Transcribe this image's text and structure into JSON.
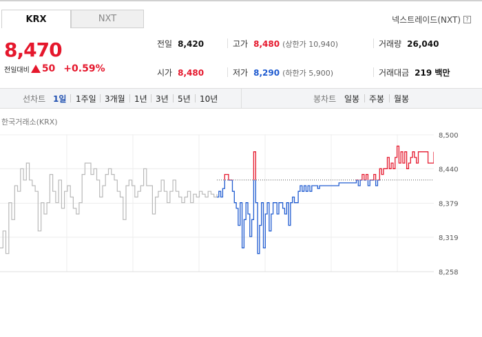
{
  "tabs": [
    "KRX",
    "NXT"
  ],
  "nxt_link": "넥스트레이드(NXT)",
  "help_icon": "?",
  "price": "8,470",
  "change_label": "전일대비",
  "change_value": "50",
  "change_pct": "+0.59%",
  "stats": {
    "prev_label": "전일",
    "prev": "8,420",
    "high_label": "고가",
    "high": "8,480",
    "upper_limit": "(상한가 10,940)",
    "volume_label": "거래량",
    "volume": "26,040",
    "open_label": "시가",
    "open": "8,480",
    "low_label": "저가",
    "low": "8,290",
    "lower_limit": "(하한가 5,900)",
    "amount_label": "거래대금",
    "amount": "219 백만"
  },
  "toolbar": {
    "line_label": "선차트",
    "periods": [
      "1일",
      "1주일",
      "3개월",
      "1년",
      "3년",
      "5년",
      "10년"
    ],
    "selected": "1일",
    "candle_label": "봉차트",
    "candles": [
      "일봉",
      "주봉",
      "월봉"
    ]
  },
  "market_label": "한국거래소(KRX)",
  "colors": {
    "up": "#e5172c",
    "down": "#1f5bd0",
    "prev_day": "#b8b8b8",
    "up_fill": "#fbd5d8",
    "down_fill": "#dbe6f6"
  },
  "chart_data": {
    "type": "line",
    "y_ticks": [
      "8,500",
      "8,440",
      "8,379",
      "8,319",
      "8,258"
    ],
    "ylim": [
      8258,
      8500
    ],
    "baseline": 8420,
    "grid": true,
    "series": [
      {
        "values": [
          8300,
          8330,
          8290,
          8380,
          8350,
          8410,
          8400,
          8440,
          8420,
          8450,
          8420,
          8410,
          8400,
          8330,
          8380,
          8360,
          8380,
          8430,
          8400,
          8380,
          8420,
          8370,
          8400,
          8410,
          8390,
          8370,
          8360,
          8380,
          8430,
          8450,
          8450,
          8430,
          8440,
          8420,
          8390,
          8410,
          8430,
          8440,
          8430,
          8420,
          8400,
          8390,
          8350,
          8410,
          8420,
          8410,
          8390,
          8400,
          8410,
          8440,
          8410,
          8410,
          8360,
          8390,
          8400,
          8420,
          8400,
          8380,
          8400,
          8420,
          8400,
          8390,
          8380,
          8390,
          8400,
          8380,
          8395,
          8390,
          8400,
          8395,
          8390,
          8400,
          8395,
          8390,
          8395
        ]
      },
      {
        "values": [
          8390,
          8400,
          8390,
          8405,
          8430,
          8430,
          8420,
          8420,
          8400,
          8380,
          8370,
          8340,
          8380,
          8300,
          8350,
          8380,
          8360,
          8320,
          8350,
          8470,
          8380,
          8290,
          8340,
          8380,
          8300,
          8360,
          8380,
          8330,
          8360,
          8380,
          8380,
          8360,
          8380,
          8380,
          8370,
          8360,
          8380,
          8340,
          8380,
          8390,
          8380,
          8380,
          8400,
          8410,
          8400,
          8410,
          8400,
          8410,
          8400,
          8410,
          8410,
          8410,
          8405,
          8410,
          8410,
          8410,
          8410,
          8410,
          8410,
          8410,
          8410,
          8410,
          8410,
          8415,
          8415,
          8415,
          8415,
          8415,
          8415,
          8415,
          8415,
          8415,
          8420,
          8410,
          8420,
          8430,
          8420,
          8430,
          8410,
          8420,
          8420,
          8430,
          8410,
          8420,
          8440,
          8430,
          8440,
          8440,
          8460,
          8440,
          8450,
          8440,
          8460,
          8480,
          8450,
          8470,
          8450,
          8470,
          8440,
          8450,
          8460,
          8470,
          8460,
          8450,
          8470,
          8470,
          8470,
          8470,
          8470,
          8450,
          8450,
          8450,
          8470
        ]
      }
    ]
  }
}
